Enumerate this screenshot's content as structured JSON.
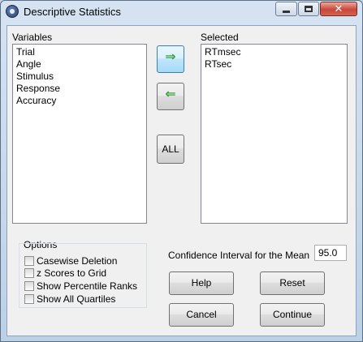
{
  "window": {
    "title": "Descriptive Statistics",
    "close_glyph": "✕"
  },
  "variables": {
    "label": "Variables",
    "items": [
      "Trial",
      "Angle",
      "Stimulus",
      "Response",
      "Accuracy"
    ]
  },
  "selected": {
    "label": "Selected",
    "items": [
      "RTmsec",
      "RTsec"
    ]
  },
  "transfer": {
    "move_right_glyph": "⇒",
    "move_left_glyph": "⇐",
    "all_label": "ALL",
    "arrow_color": "#3aa23a"
  },
  "options": {
    "label": "Options",
    "checkboxes": [
      {
        "label": "Casewise Deletion",
        "checked": false
      },
      {
        "label": "z Scores to Grid",
        "checked": false
      },
      {
        "label": "Show Percentile Ranks",
        "checked": false
      },
      {
        "label": "Show All Quartiles",
        "checked": false
      }
    ]
  },
  "confidence": {
    "label": "Confidence Interval for the Mean",
    "value": "95.0"
  },
  "buttons": {
    "help": "Help",
    "reset": "Reset",
    "cancel": "Cancel",
    "continue": "Continue"
  },
  "icons": {
    "app": "app-icon",
    "minimize": "minimize-icon",
    "maximize": "maximize-icon",
    "close": "close-icon"
  }
}
